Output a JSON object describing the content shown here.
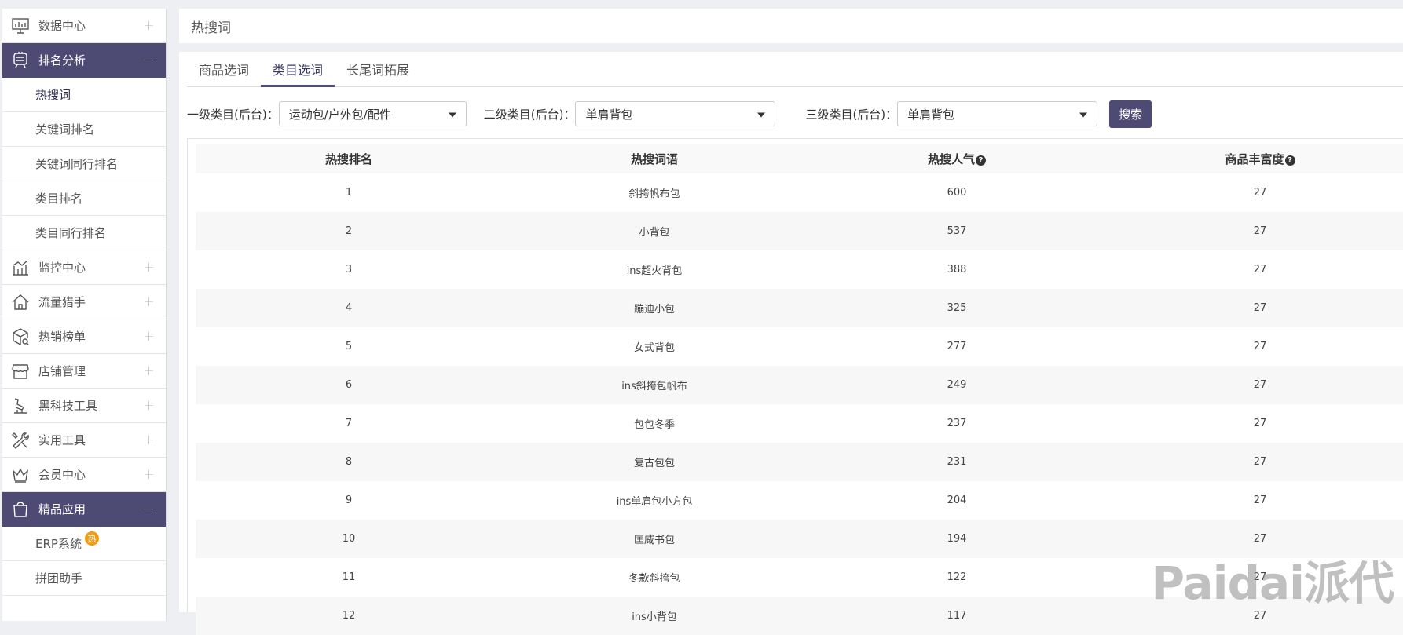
{
  "sidebar": {
    "items": [
      {
        "label": "数据中心",
        "icon": "monitor-chart-icon",
        "state": "collapsed",
        "toggle": "+"
      },
      {
        "label": "排名分析",
        "icon": "trophy-icon",
        "state": "expanded",
        "toggle": "−",
        "children": [
          "热搜词",
          "关键词排名",
          "关键词同行排名",
          "类目排名",
          "类目同行排名"
        ]
      },
      {
        "label": "监控中心",
        "icon": "line-chart-icon",
        "state": "collapsed",
        "toggle": "+"
      },
      {
        "label": "流量猎手",
        "icon": "home-icon",
        "state": "collapsed",
        "toggle": "+"
      },
      {
        "label": "热销榜单",
        "icon": "box-search-icon",
        "state": "collapsed",
        "toggle": "+"
      },
      {
        "label": "店铺管理",
        "icon": "store-icon",
        "state": "collapsed",
        "toggle": "+"
      },
      {
        "label": "黑科技工具",
        "icon": "lab-tool-icon",
        "state": "collapsed",
        "toggle": "+"
      },
      {
        "label": "实用工具",
        "icon": "tools-icon",
        "state": "collapsed",
        "toggle": "+"
      },
      {
        "label": "会员中心",
        "icon": "crown-icon",
        "state": "collapsed",
        "toggle": "+"
      },
      {
        "label": "精品应用",
        "icon": "shopping-bag-icon",
        "state": "expanded",
        "toggle": "−",
        "children": [
          "ERP系统",
          "拼团助手"
        ],
        "badge": "热"
      }
    ]
  },
  "header": {
    "title": "热搜词"
  },
  "tabs": [
    {
      "label": "商品选词",
      "active": false
    },
    {
      "label": "类目选词",
      "active": true
    },
    {
      "label": "长尾词拓展",
      "active": false
    }
  ],
  "filters": {
    "level1": {
      "label": "一级类目(后台)：",
      "value": "运动包/户外包/配件"
    },
    "level2": {
      "label": "二级类目(后台)：",
      "value": "单肩背包"
    },
    "level3": {
      "label": "三级类目(后台)：",
      "value": "单肩背包"
    },
    "search_label": "搜索"
  },
  "table": {
    "headers": [
      "热搜排名",
      "热搜词语",
      "热搜人气",
      "商品丰富度"
    ],
    "help_icon": "?",
    "rows": [
      [
        "1",
        "斜挎帆布包",
        "600",
        "27"
      ],
      [
        "2",
        "小背包",
        "537",
        "27"
      ],
      [
        "3",
        "ins超火背包",
        "388",
        "27"
      ],
      [
        "4",
        "蹦迪小包",
        "325",
        "27"
      ],
      [
        "5",
        "女式背包",
        "277",
        "27"
      ],
      [
        "6",
        "ins斜挎包帆布",
        "249",
        "27"
      ],
      [
        "7",
        "包包冬季",
        "237",
        "27"
      ],
      [
        "8",
        "复古包包",
        "231",
        "27"
      ],
      [
        "9",
        "ins单肩包小方包",
        "204",
        "27"
      ],
      [
        "10",
        "匡威书包",
        "194",
        "27"
      ],
      [
        "11",
        "冬款斜挎包",
        "122",
        "27"
      ],
      [
        "12",
        "ins小背包",
        "117",
        "27"
      ]
    ]
  },
  "watermark": "Paidai派代",
  "colors": {
    "accent": "#4d4a73",
    "badge": "#f39c12",
    "background": "#edeff3"
  }
}
